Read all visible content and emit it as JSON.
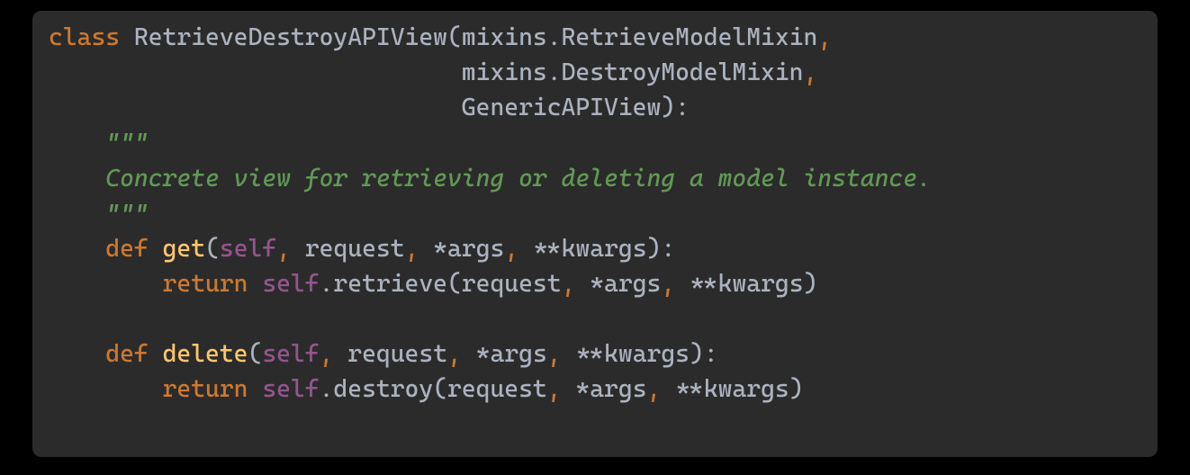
{
  "code": {
    "class_kw": "class",
    "classname": "RetrieveDestroyAPIView",
    "base1_prefix": "mixins",
    "base1_name": "RetrieveModelMixin",
    "base2_prefix": "mixins",
    "base2_name": "DestroyModelMixin",
    "base3": "GenericAPIView",
    "docquote_open": "\"\"\"",
    "docstring": "Concrete view for retrieving or deleting a model instance.",
    "docquote_close": "\"\"\"",
    "def_kw": "def",
    "func1": "get",
    "func2": "delete",
    "self": "self",
    "request": "request",
    "args": "args",
    "kwargs": "kwargs",
    "return_kw": "return",
    "call1": "retrieve",
    "call2": "destroy",
    "comma": ",",
    "colon": ":",
    "dot": ".",
    "lparen": "(",
    "rparen": ")",
    "star": "*",
    "dstar": "**"
  }
}
